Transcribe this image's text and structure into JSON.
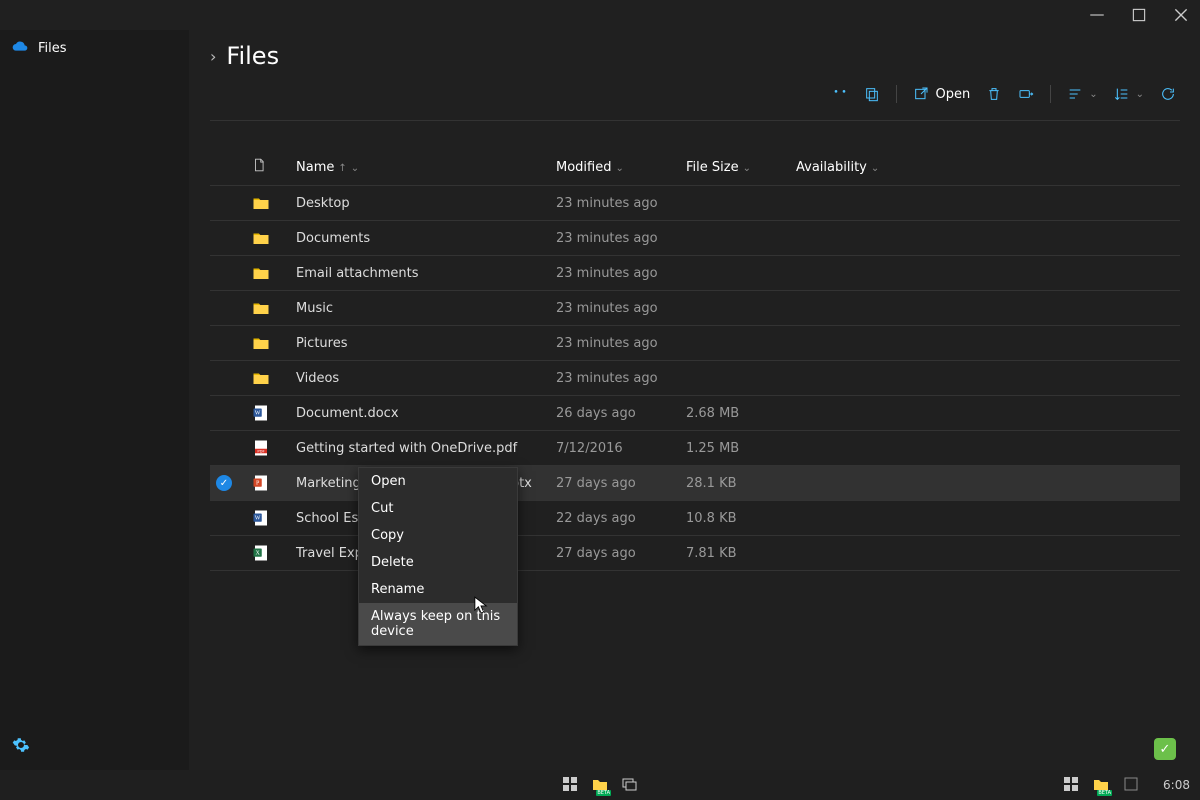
{
  "app": {
    "sidebar_label": "Files"
  },
  "titlebar": {
    "min": "—",
    "max": "",
    "close": "✕"
  },
  "breadcrumb": {
    "title": "Files"
  },
  "toolbar": {
    "open_label": "Open"
  },
  "columns": {
    "name": "Name",
    "modified": "Modified",
    "filesize": "File Size",
    "availability": "Availability"
  },
  "rows": [
    {
      "type": "folder",
      "name": "Desktop",
      "modified": "23 minutes ago",
      "size": "",
      "selected": false
    },
    {
      "type": "folder",
      "name": "Documents",
      "modified": "23 minutes ago",
      "size": "",
      "selected": false
    },
    {
      "type": "folder",
      "name": "Email attachments",
      "modified": "23 minutes ago",
      "size": "",
      "selected": false
    },
    {
      "type": "folder",
      "name": "Music",
      "modified": "23 minutes ago",
      "size": "",
      "selected": false
    },
    {
      "type": "folder",
      "name": "Pictures",
      "modified": "23 minutes ago",
      "size": "",
      "selected": false
    },
    {
      "type": "folder",
      "name": "Videos",
      "modified": "23 minutes ago",
      "size": "",
      "selected": false
    },
    {
      "type": "docx",
      "name": "Document.docx",
      "modified": "26 days ago",
      "size": "2.68 MB",
      "selected": false
    },
    {
      "type": "pdf",
      "name": "Getting started with OneDrive.pdf",
      "modified": "7/12/2016",
      "size": "1.25 MB",
      "selected": false
    },
    {
      "type": "pptx",
      "name": "Marketing Strategy - 2020 Plan.pptx",
      "modified": "27 days ago",
      "size": "28.1 KB",
      "selected": true
    },
    {
      "type": "docx",
      "name": "School Essay.docx",
      "modified": "22 days ago",
      "size": "10.8 KB",
      "selected": false
    },
    {
      "type": "xlsx",
      "name": "Travel Expenses.xlsx",
      "modified": "27 days ago",
      "size": "7.81 KB",
      "selected": false
    }
  ],
  "context_menu": {
    "items": [
      {
        "label": "Open",
        "hover": false
      },
      {
        "label": "Cut",
        "hover": false
      },
      {
        "label": "Copy",
        "hover": false
      },
      {
        "label": "Delete",
        "hover": false
      },
      {
        "label": "Rename",
        "hover": false
      },
      {
        "label": "Always keep on this device",
        "hover": true
      }
    ]
  },
  "taskbar": {
    "clock": "6:08"
  },
  "colors": {
    "accent": "#4cc2ff",
    "folder": "#ffd24a",
    "word": "#2b579a",
    "ppt": "#d24726",
    "excel": "#217346",
    "pdf": "#e8e8e8"
  }
}
